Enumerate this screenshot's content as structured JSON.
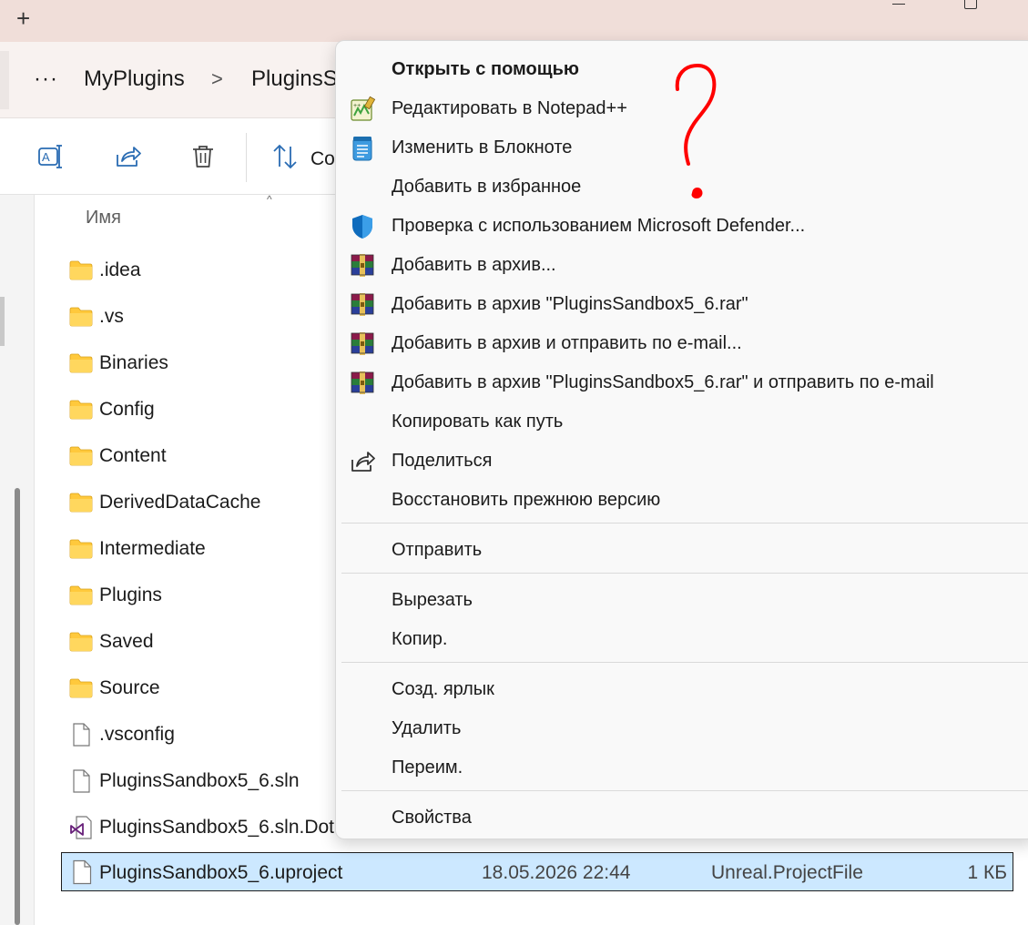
{
  "titlebar": {
    "new_tab_label": "+"
  },
  "breadcrumb": {
    "more": "···",
    "items": [
      "MyPlugins",
      "PluginsS"
    ],
    "separator": ">"
  },
  "toolbar": {
    "sort_label": "Co"
  },
  "file_list": {
    "header_name": "Имя",
    "items": [
      {
        "name": ".idea",
        "kind": "folder"
      },
      {
        "name": ".vs",
        "kind": "folder"
      },
      {
        "name": "Binaries",
        "kind": "folder"
      },
      {
        "name": "Config",
        "kind": "folder"
      },
      {
        "name": "Content",
        "kind": "folder"
      },
      {
        "name": "DerivedDataCache",
        "kind": "folder"
      },
      {
        "name": "Intermediate",
        "kind": "folder"
      },
      {
        "name": "Plugins",
        "kind": "folder"
      },
      {
        "name": "Saved",
        "kind": "folder"
      },
      {
        "name": "Source",
        "kind": "folder"
      },
      {
        "name": ".vsconfig",
        "kind": "file"
      },
      {
        "name": "PluginsSandbox5_6.sln",
        "kind": "file"
      },
      {
        "name": "PluginsSandbox5_6.sln.DotS",
        "kind": "vs-file"
      }
    ],
    "selected": {
      "name": "PluginsSandbox5_6.uproject",
      "date": "18.05.2026 22:44",
      "type": "Unreal.ProjectFile",
      "size": "1 КБ"
    }
  },
  "context_menu": {
    "items": [
      {
        "label": "Открыть с помощью",
        "icon": "none",
        "bold": true
      },
      {
        "label": "Редактировать в Notepad++",
        "icon": "notepad-plus-plus-icon"
      },
      {
        "label": "Изменить в Блокноте",
        "icon": "notepad-icon"
      },
      {
        "label": "Добавить в избранное",
        "icon": "none"
      },
      {
        "label": "Проверка с использованием Microsoft Defender...",
        "icon": "defender-shield-icon"
      },
      {
        "label": "Добавить в архив...",
        "icon": "winrar-icon"
      },
      {
        "label": "Добавить в архив \"PluginsSandbox5_6.rar\"",
        "icon": "winrar-icon"
      },
      {
        "label": "Добавить в архив и отправить по e-mail...",
        "icon": "winrar-icon"
      },
      {
        "label": "Добавить в архив \"PluginsSandbox5_6.rar\" и отправить по e-mail",
        "icon": "winrar-icon"
      },
      {
        "label": "Копировать как путь",
        "icon": "none"
      },
      {
        "label": "Поделиться",
        "icon": "share-icon"
      },
      {
        "label": "Восстановить прежнюю версию",
        "icon": "none"
      },
      {
        "label": "Отправить",
        "icon": "none"
      },
      {
        "label": "Вырезать",
        "icon": "none"
      },
      {
        "label": "Копир.",
        "icon": "none"
      },
      {
        "label": "Созд. ярлык",
        "icon": "none"
      },
      {
        "label": "Удалить",
        "icon": "none"
      },
      {
        "label": "Переим.",
        "icon": "none"
      },
      {
        "label": "Свойства",
        "icon": "none"
      }
    ]
  },
  "annotation": {
    "symbol": "?",
    "color": "#ff0000"
  },
  "colors": {
    "selection": "#cce8ff",
    "folder": "#ffc93c",
    "titlebar": "#f0ded9"
  }
}
